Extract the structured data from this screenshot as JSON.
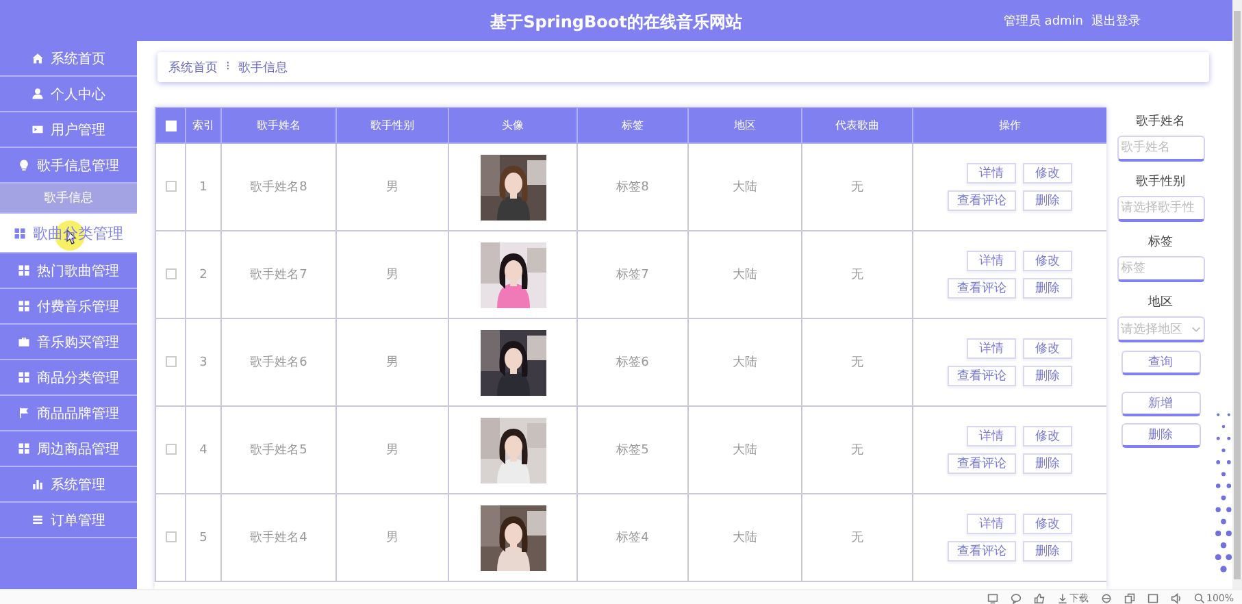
{
  "header": {
    "title": "基于SpringBoot的在线音乐网站",
    "user": "管理员 admin",
    "logout": "退出登录"
  },
  "sidebar": {
    "items": [
      {
        "label": "系统首页",
        "selected": false
      },
      {
        "label": "个人中心",
        "selected": false
      },
      {
        "label": "用户管理",
        "selected": false
      },
      {
        "label": "歌手信息管理",
        "selected": false,
        "expanded": true,
        "children": [
          {
            "label": "歌手信息",
            "selected": false
          }
        ]
      },
      {
        "label": "歌曲分类管理",
        "selected": true
      },
      {
        "label": "热门歌曲管理",
        "selected": false
      },
      {
        "label": "付费音乐管理",
        "selected": false
      },
      {
        "label": "音乐购买管理",
        "selected": false
      },
      {
        "label": "商品分类管理",
        "selected": false
      },
      {
        "label": "商品品牌管理",
        "selected": false
      },
      {
        "label": "周边商品管理",
        "selected": false
      },
      {
        "label": "系统管理",
        "selected": false
      },
      {
        "label": "订单管理",
        "selected": false
      }
    ]
  },
  "breadcrumb": {
    "items": [
      "系统首页",
      "歌手信息"
    ],
    "separator": "⁝"
  },
  "table": {
    "select_all": {
      "checked": false
    },
    "columns": [
      "索引",
      "歌手姓名",
      "歌手性别",
      "头像",
      "标签",
      "地区",
      "代表歌曲",
      "操作"
    ],
    "rows": [
      {
        "checked": false,
        "index": "1",
        "name": "歌手姓名8",
        "gender": "男",
        "avatar": {
          "kind": "picture"
        },
        "tag": "标签8",
        "region": "大陆",
        "song": "无",
        "actions": [
          "详情",
          "修改",
          "查看评论",
          "删除"
        ]
      },
      {
        "checked": false,
        "index": "2",
        "name": "歌手姓名7",
        "gender": "男",
        "avatar": {
          "kind": "picture"
        },
        "tag": "标签7",
        "region": "大陆",
        "song": "无",
        "actions": [
          "详情",
          "修改",
          "查看评论",
          "删除"
        ]
      },
      {
        "checked": false,
        "index": "3",
        "name": "歌手姓名6",
        "gender": "男",
        "avatar": {
          "kind": "picture"
        },
        "tag": "标签6",
        "region": "大陆",
        "song": "无",
        "actions": [
          "详情",
          "修改",
          "查看评论",
          "删除"
        ]
      },
      {
        "checked": false,
        "index": "4",
        "name": "歌手姓名5",
        "gender": "男",
        "avatar": {
          "kind": "picture"
        },
        "tag": "标签5",
        "region": "大陆",
        "song": "无",
        "actions": [
          "详情",
          "修改",
          "查看评论",
          "删除"
        ]
      },
      {
        "checked": false,
        "index": "5",
        "name": "歌手姓名4",
        "gender": "男",
        "avatar": {
          "kind": "picture"
        },
        "tag": "标签4",
        "region": "大陆",
        "song": "无",
        "actions": [
          "详情",
          "修改",
          "查看评论",
          "删除"
        ]
      }
    ]
  },
  "filters": {
    "fields": [
      {
        "kind": "input",
        "label": "歌手姓名",
        "placeholder": "歌手姓名"
      },
      {
        "kind": "input",
        "label": "歌手性别",
        "placeholder": "请选择歌手性"
      },
      {
        "kind": "input",
        "label": "标签",
        "placeholder": "标签"
      },
      {
        "kind": "select",
        "label": "地区",
        "placeholder": "请选择地区"
      }
    ],
    "buttons": [
      "查询",
      "新增",
      "删除"
    ]
  },
  "player_bar": {
    "download": "下载",
    "zoom": "100%"
  }
}
